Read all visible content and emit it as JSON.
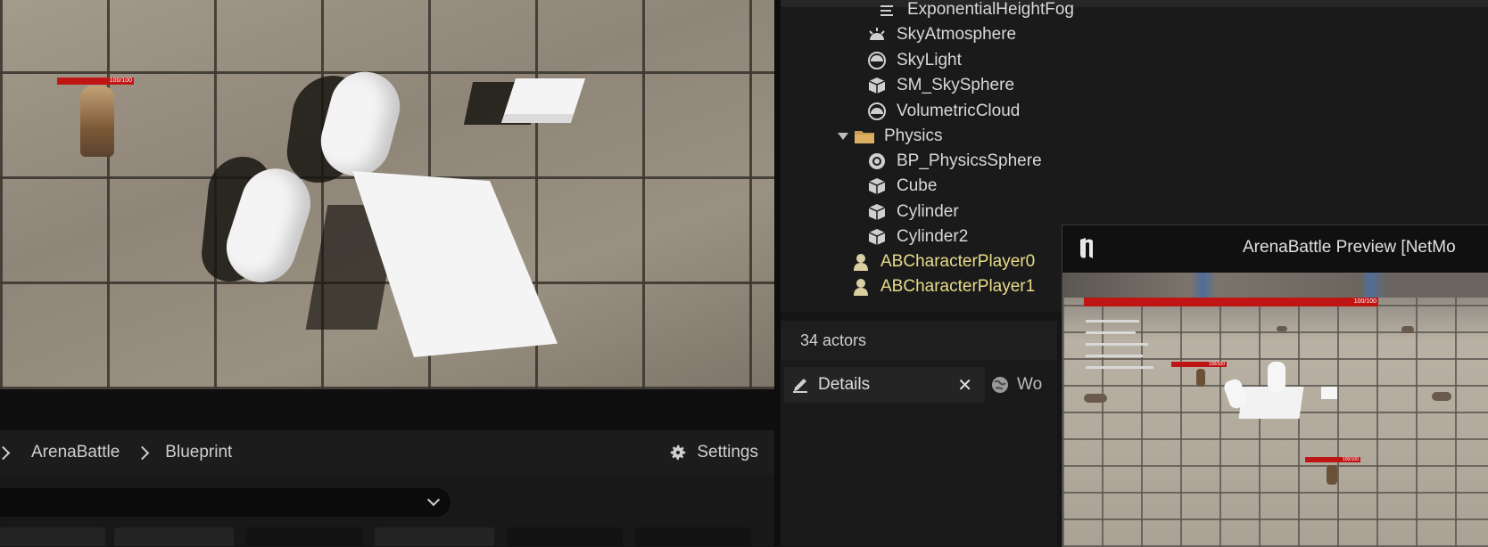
{
  "viewport": {
    "character_hp_label": "100/100"
  },
  "content_browser": {
    "breadcrumb": [
      "ArenaBattle",
      "Blueprint"
    ],
    "settings_label": "Settings"
  },
  "outliner": {
    "items": [
      {
        "label": "ExponentialHeightFog",
        "icon": "fog-icon"
      },
      {
        "label": "SkyAtmosphere",
        "icon": "sky-atmosphere-icon"
      },
      {
        "label": "SkyLight",
        "icon": "sky-light-icon"
      },
      {
        "label": "SM_SkySphere",
        "icon": "static-mesh-icon"
      },
      {
        "label": "VolumetricCloud",
        "icon": "cloud-icon"
      },
      {
        "label": "Physics",
        "icon": "folder-icon"
      },
      {
        "label": "BP_PhysicsSphere",
        "icon": "blueprint-sphere-icon"
      },
      {
        "label": "Cube",
        "icon": "static-mesh-icon"
      },
      {
        "label": "Cylinder",
        "icon": "static-mesh-icon"
      },
      {
        "label": "Cylinder2",
        "icon": "static-mesh-icon"
      },
      {
        "label": "ABCharacterPlayer0",
        "icon": "character-icon"
      },
      {
        "label": "ABCharacterPlayer1",
        "icon": "character-icon"
      }
    ],
    "actor_count": "34 actors"
  },
  "details": {
    "tab_label": "Details",
    "second_tab_label": "Wo"
  },
  "preview": {
    "title": "ArenaBattle Preview [NetMo",
    "hp_label_main": "100/100",
    "hp_label_enemy_a": "100/100",
    "hp_label_enemy_b": "100/100"
  },
  "colors": {
    "accent_hp": "#c01515",
    "character_label": "#e8dc8a",
    "panel_bg": "#1a1a1a"
  }
}
